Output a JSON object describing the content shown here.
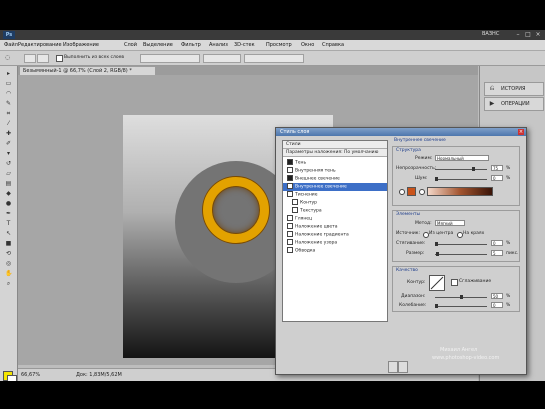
{
  "app": {
    "logo": "Ps",
    "workspace": "ВАЗНС",
    "window_controls": [
      "–",
      "□",
      "×"
    ]
  },
  "menu": {
    "items": [
      "Файл",
      "Редактирование",
      "Изображение",
      "Слой",
      "Выделение",
      "Фильтр",
      "Анализ",
      "3D-стек",
      "Просмотр",
      "Окно",
      "Справка"
    ]
  },
  "options_bar": {
    "checkbox_label": "Выполнить из всех слоев"
  },
  "document": {
    "tab_title": "Безымянный-1 @ 66,7% (Слой 2, RGB/8) *"
  },
  "status": {
    "zoom": "66,67%",
    "doc_size": "Док: 1,83М/5,62М"
  },
  "right_panel": {
    "items": [
      "ИСТОРИЯ",
      "ОПЕРАЦИИ"
    ]
  },
  "dialog": {
    "title": "Стиль слоя",
    "close": "×",
    "style_list": [
      {
        "label": "Стили",
        "kind": "header",
        "checked": false
      },
      {
        "label": "Параметры наложения: По умолчанию",
        "kind": "header",
        "checked": false
      },
      {
        "label": "Тень",
        "kind": "item",
        "checked": true
      },
      {
        "label": "Внутренняя тень",
        "kind": "item",
        "checked": false
      },
      {
        "label": "Внешнее свечение",
        "kind": "item",
        "checked": true
      },
      {
        "label": "Внутреннее свечение",
        "kind": "item",
        "checked": false
      },
      {
        "label": "Тиснение",
        "kind": "item",
        "checked": false
      },
      {
        "label": "Контур",
        "kind": "sub",
        "checked": false
      },
      {
        "label": "Текстура",
        "kind": "sub",
        "checked": false
      },
      {
        "label": "Глянец",
        "kind": "item",
        "checked": false
      },
      {
        "label": "Наложение цвета",
        "kind": "item",
        "checked": false
      },
      {
        "label": "Наложение градиента",
        "kind": "item",
        "checked": false
      },
      {
        "label": "Наложение узора",
        "kind": "item",
        "checked": false
      },
      {
        "label": "Обводка",
        "kind": "item",
        "checked": false
      }
    ],
    "selected_index": 5,
    "panel": {
      "title": "Внутреннее свечение",
      "structure": {
        "title": "Структура",
        "blend_label": "Режим:",
        "blend_value": "Нормальный",
        "opacity_label": "Непрозрачность:",
        "opacity_value": "75",
        "opacity_unit": "%",
        "opacity_fraction": 0.75,
        "noise_label": "Шум:",
        "noise_value": "0",
        "noise_unit": "%",
        "noise_fraction": 0.0,
        "glow_color": "#c9531b"
      },
      "elements": {
        "title": "Элементы",
        "method_label": "Метод:",
        "method_value": "Мягкий",
        "source_label": "Источник:",
        "source_center": "Из центра",
        "source_edge": "На краях",
        "choke_label": "Стягивание:",
        "choke_value": "0",
        "choke_unit": "%",
        "choke_fraction": 0.0,
        "size_label": "Размер:",
        "size_value": "5",
        "size_unit": "пикс.",
        "size_fraction": 0.02
      },
      "quality": {
        "title": "Качество",
        "contour_label": "Контур:",
        "antialias_label": "Сглаживание",
        "range_label": "Диапазон:",
        "range_value": "50",
        "range_unit": "%",
        "range_fraction": 0.5,
        "jitter_label": "Колебание:",
        "jitter_value": "0",
        "jitter_unit": "%",
        "jitter_fraction": 0.0
      }
    }
  },
  "watermark": {
    "line1": "Михаил Ангел",
    "line2": "www.photoshop-video.com"
  },
  "colors": {
    "accent": "#3d6fc7",
    "ring": "#e3a200",
    "foreground": "#f5e600"
  }
}
